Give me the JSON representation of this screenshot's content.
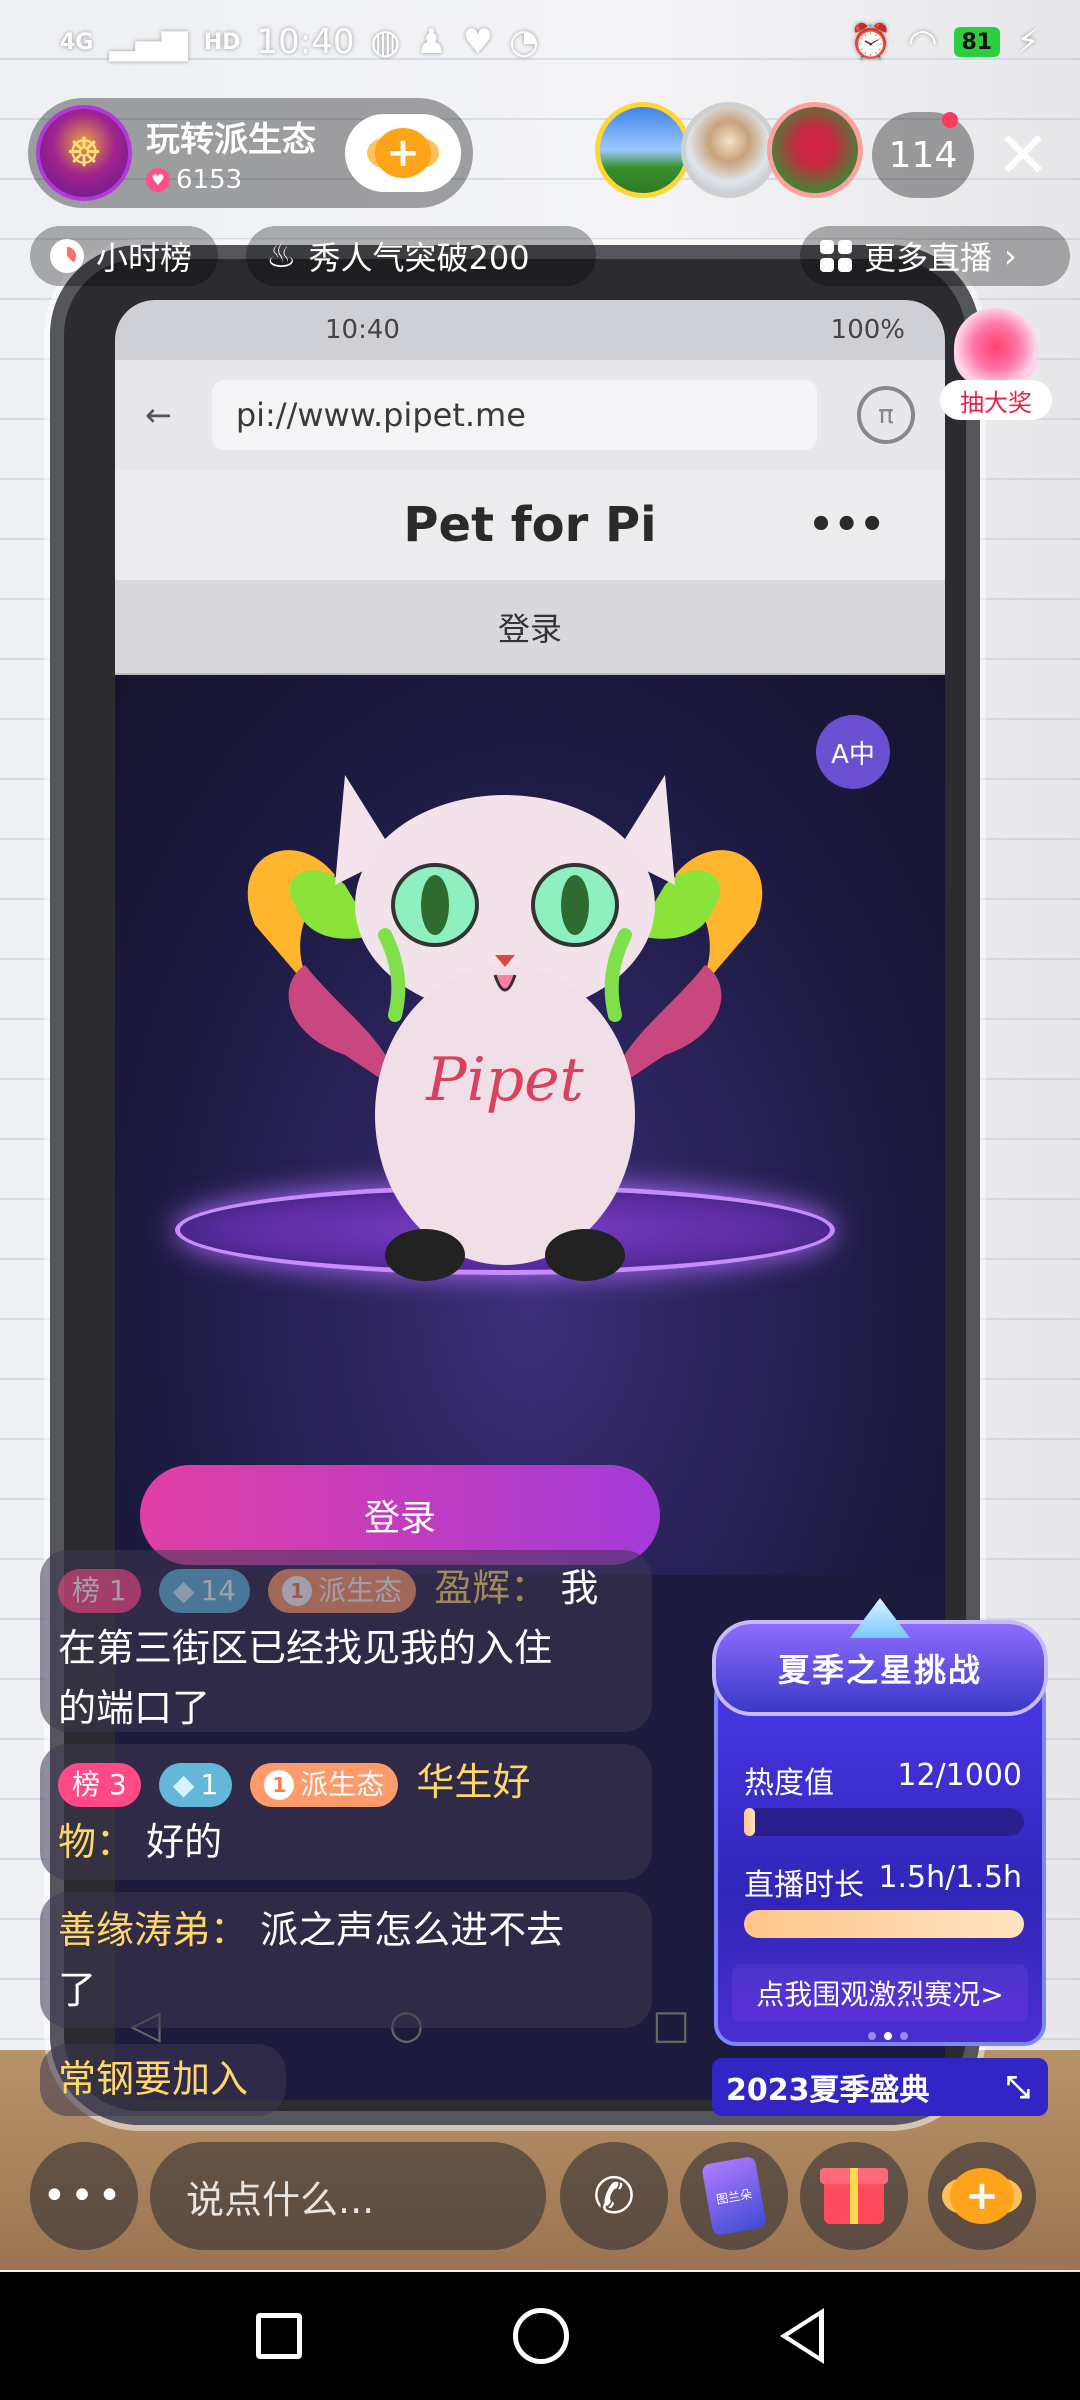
{
  "status_bar": {
    "network": "4G",
    "hd": "HD",
    "time": "10:40",
    "battery": "81"
  },
  "host": {
    "name": "玩转派生态",
    "likes": "6153",
    "follow_icon": "plus-heart-icon"
  },
  "viewers": {
    "count": "114"
  },
  "top_pills": {
    "rank": "小时榜",
    "heat": "秀人气突破200",
    "more": "更多直播"
  },
  "lottery": {
    "label": "抽大奖"
  },
  "stream_phone": {
    "time": "10:40",
    "battery": "100%",
    "url": "pi://www.pipet.me",
    "title": "Pet for Pi",
    "login_top": "登录",
    "translate_icon": "translate-icon",
    "pet_text": "Pipet",
    "login_button": "登录"
  },
  "chat": {
    "messages": [
      {
        "rank_badge": "榜 1",
        "diamond_badge": "14",
        "fan_badge": "派生态",
        "user": "盈辉：",
        "text_a": "我",
        "text_b": "在第三街区已经找见我的入住",
        "text_c": "的端口了"
      },
      {
        "rank_badge": "榜 3",
        "diamond_badge": "1",
        "fan_badge": "派生态",
        "user_a": "华生好",
        "user_b": "物：",
        "text": "好的"
      },
      {
        "user": "善缘涛弟：",
        "text_a": "派之声怎么进不去",
        "text_b": "了"
      },
      {
        "text": "常钢要加入"
      }
    ]
  },
  "event": {
    "title": "夏季之星挑战",
    "heat_label": "热度值",
    "heat_value": "12/1000",
    "heat_progress": 0.012,
    "duration_label": "直播时长",
    "duration_value": "1.5h/1.5h",
    "duration_progress": 1.0,
    "cta": "点我围观激烈赛况>",
    "footer": "2023夏季盛典"
  },
  "toolbar": {
    "more": "•••",
    "input_placeholder": "说点什么...",
    "card_text": "图兰朵"
  }
}
